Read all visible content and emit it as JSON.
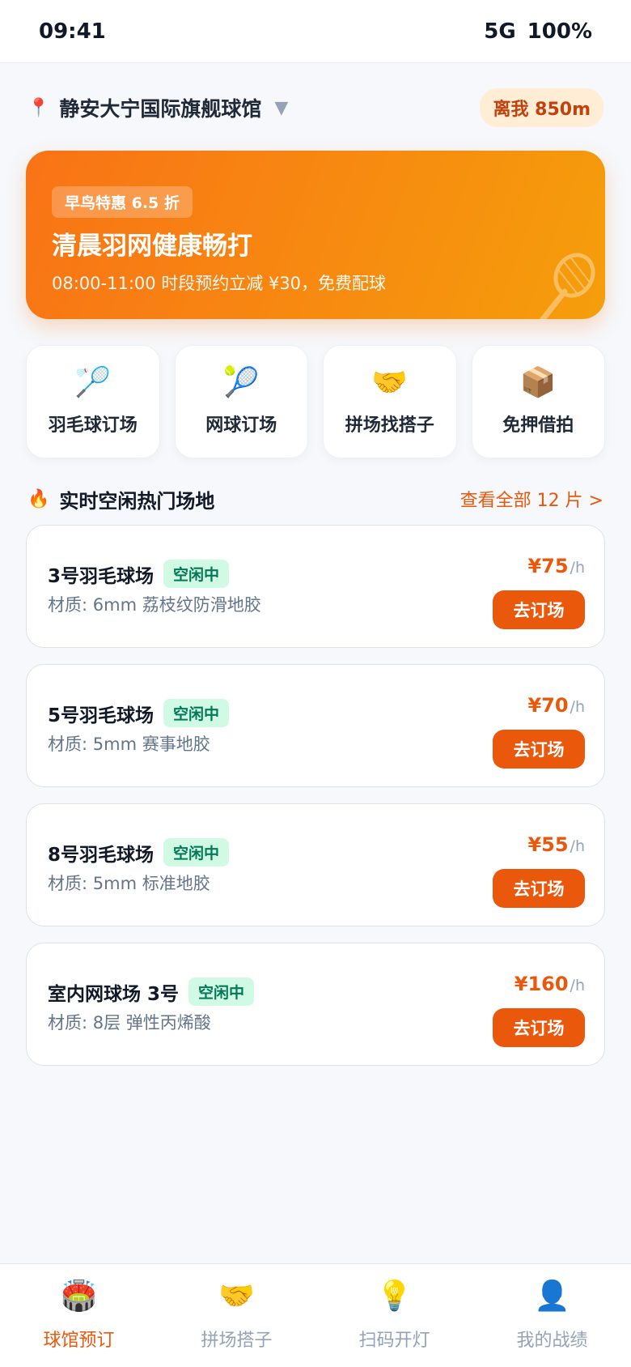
{
  "status_bar": {
    "time": "09:41",
    "network": "5G",
    "battery": "100%"
  },
  "venue": {
    "pin_icon": "📍",
    "name": "静安大宁国际旗舰球馆",
    "caret": "▼",
    "distance": "离我 850m"
  },
  "promo": {
    "tag": "早鸟特惠 6.5 折",
    "title": "清晨羽网健康畅打",
    "subtitle": "08:00-11:00 时段预约立减 ¥30，免费配球",
    "gradient": [
      "#f97316",
      "#f59e0b"
    ]
  },
  "quick_actions": [
    {
      "icon": "🏸",
      "label": "羽毛球订场"
    },
    {
      "icon": "🎾",
      "label": "网球订场"
    },
    {
      "icon": "🤝",
      "label": "拼场找搭子"
    },
    {
      "icon": "📦",
      "label": "免押借拍"
    }
  ],
  "section": {
    "fire_icon": "🔥",
    "title": "实时空闲热门场地",
    "link": "查看全部 12 片 >"
  },
  "courts": [
    {
      "name": "3号羽毛球场",
      "status": "空闲中",
      "material": "材质: 6mm 荔枝纹防滑地胶",
      "price": "¥75",
      "unit": "/h",
      "button": "去订场"
    },
    {
      "name": "5号羽毛球场",
      "status": "空闲中",
      "material": "材质: 5mm 赛事地胶",
      "price": "¥70",
      "unit": "/h",
      "button": "去订场"
    },
    {
      "name": "8号羽毛球场",
      "status": "空闲中",
      "material": "材质: 5mm 标准地胶",
      "price": "¥55",
      "unit": "/h",
      "button": "去订场"
    },
    {
      "name": "室内网球场 3号",
      "status": "空闲中",
      "material": "材质: 8层 弹性丙烯酸",
      "price": "¥160",
      "unit": "/h",
      "button": "去订场"
    }
  ],
  "tabs": [
    {
      "icon": "🏟️",
      "label": "球馆预订",
      "active": true
    },
    {
      "icon": "🤝",
      "label": "拼场搭子",
      "active": false
    },
    {
      "icon": "💡",
      "label": "扫码开灯",
      "active": false
    },
    {
      "icon": "👤",
      "label": "我的战绩",
      "active": false
    }
  ],
  "colors": {
    "accent": "#ea580c",
    "status_chip_bg": "#d1fae5",
    "status_chip_text": "#047857"
  }
}
